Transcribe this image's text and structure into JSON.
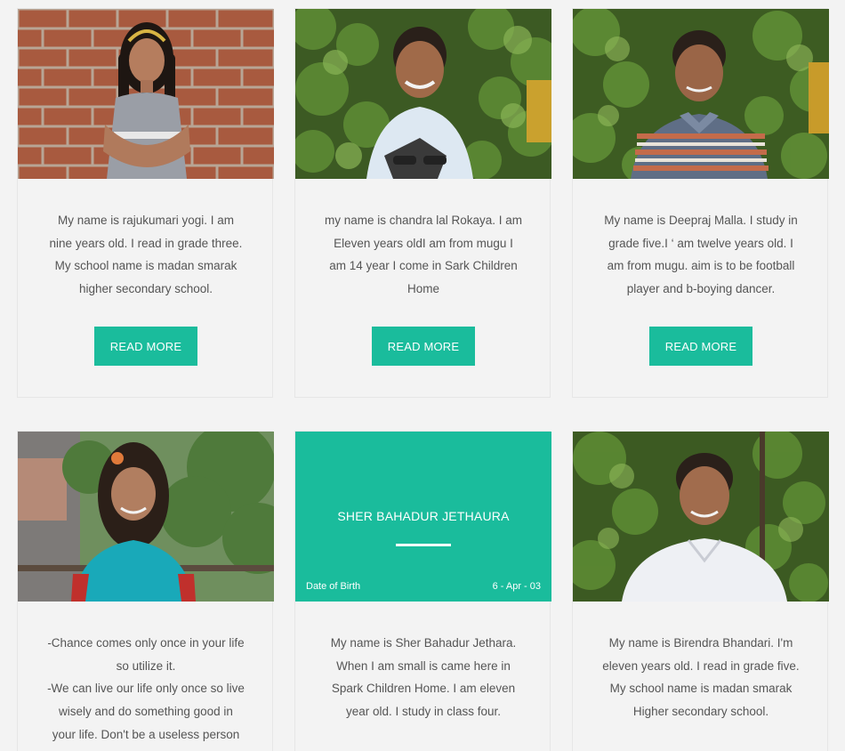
{
  "cards": [
    {
      "description_lines": [
        "My name is rajukumari yogi. I am",
        "nine years old. I read in grade three.",
        "My school name is madan smarak",
        "higher secondary school."
      ],
      "button_label": "READ MORE"
    },
    {
      "description_lines": [
        "my name is chandra lal Rokaya. I am",
        "Eleven years oldI am from mugu I",
        "am 14 year I come in Sark Children",
        "Home"
      ],
      "button_label": "READ MORE"
    },
    {
      "description_lines": [
        "My name is Deepraj Malla. I study in",
        "grade five.I ‘ am twelve years old. I",
        "am from mugu. aim is to be football",
        "player and b-boying dancer."
      ],
      "button_label": "READ MORE"
    },
    {
      "description_lines": [
        "-Chance comes only once in your life",
        "so utilize it.",
        "-We can live our life only once so live",
        "wisely and do something good in",
        "your life. Don't be a useless person"
      ]
    },
    {
      "overlay": {
        "name": "SHER BAHADUR JETHAURA",
        "dob_label": "Date of Birth",
        "dob_value": "6 - Apr - 03"
      },
      "description_lines": [
        "My name is Sher Bahadur Jethara.",
        "When I am small is came here in",
        "Spark Children Home. I am eleven",
        "year old. I study in class four."
      ]
    },
    {
      "description_lines": [
        "My name is Birendra Bhandari. I'm",
        "eleven years old. I read in grade five.",
        "My school name is madan smarak",
        "Higher secondary school."
      ]
    }
  ],
  "colors": {
    "accent": "#1abc9c",
    "page_background": "#f3f3f3",
    "text": "#555555"
  }
}
